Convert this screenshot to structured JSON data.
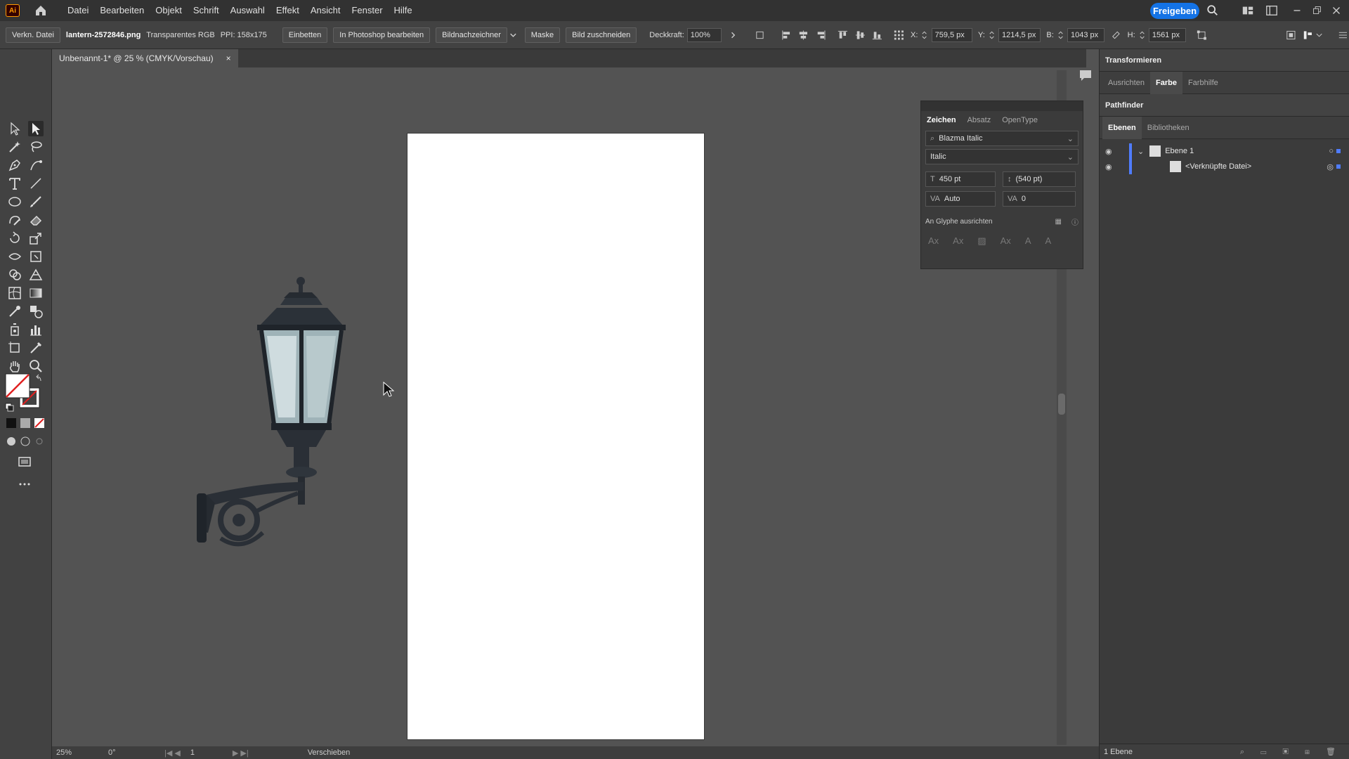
{
  "app": {
    "logo": "Ai",
    "accent": "#ff9a00"
  },
  "menu": {
    "items": [
      "Datei",
      "Bearbeiten",
      "Objekt",
      "Schrift",
      "Auswahl",
      "Effekt",
      "Ansicht",
      "Fenster",
      "Hilfe"
    ],
    "share_label": "Freigeben"
  },
  "control": {
    "link_label": "Verkn. Datei",
    "filename": "lantern-2572846.png",
    "colormode": "Transparentes RGB",
    "ppi": "PPI: 158x175",
    "embed": "Einbetten",
    "edit_ps": "In Photoshop bearbeiten",
    "trace": "Bildnachzeichner",
    "mask": "Maske",
    "crop": "Bild zuschneiden",
    "opacity_label": "Deckkraft:",
    "opacity": "100%",
    "x_label": "X:",
    "x_val": "759,5 px",
    "y_label": "Y:",
    "y_val": "1214,5 px",
    "w_label": "B:",
    "w_val": "1043 px",
    "h_label": "H:",
    "h_val": "1561 px"
  },
  "document": {
    "tab_title": "Unbenannt-1* @ 25 % (CMYK/Vorschau)",
    "close": "×"
  },
  "status": {
    "zoom": "25%",
    "rotation": "0°",
    "page": "1",
    "tool": "Verschieben"
  },
  "char_panel": {
    "tabs": [
      "Zeichen",
      "Absatz",
      "OpenType"
    ],
    "font": "Blazma Italic",
    "style": "Italic",
    "size": "450 pt",
    "leading": "(540 pt)",
    "kerning": "Auto",
    "tracking": "0",
    "glyph_align": "An Glyphe ausrichten"
  },
  "dock": {
    "transform": "Transformieren",
    "tabs1": [
      "Ausrichten",
      "Farbe",
      "Farbhilfe"
    ],
    "pathfinder": "Pathfinder",
    "tabs2": [
      "Ebenen",
      "Bibliotheken"
    ],
    "layer_name": "Ebene 1",
    "sublayer_name": "<Verknüpfte Datei>",
    "layer_color": "#4f7cff",
    "footer": "1 Ebene"
  }
}
